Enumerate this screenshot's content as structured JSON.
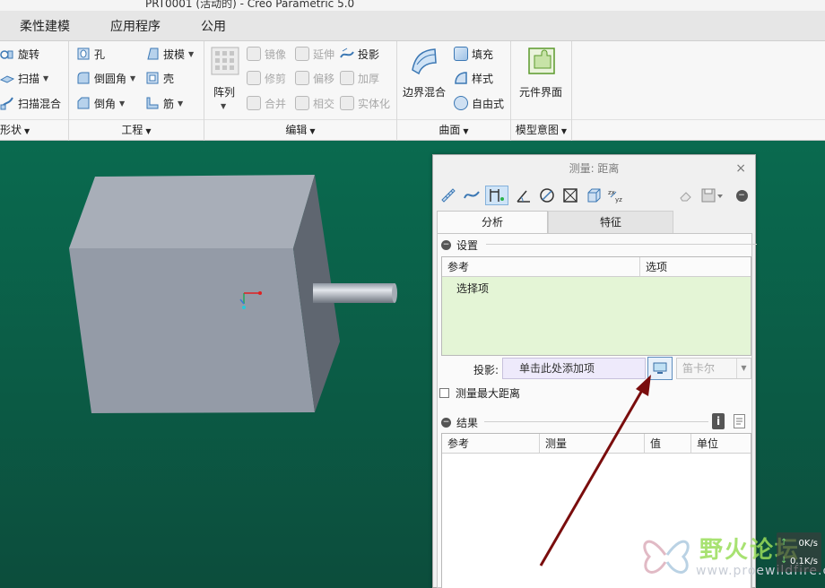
{
  "window": {
    "title": "PRT0001 (活动的) - Creo Parametric 5.0"
  },
  "tabs": [
    "柔性建模",
    "应用程序",
    "公用"
  ],
  "ribbon": {
    "groups": {
      "shape": {
        "label": "形状",
        "items": [
          "旋转",
          "扫描",
          "扫描混合"
        ]
      },
      "engineering": {
        "label": "工程",
        "items": [
          "孔",
          "倒圆角",
          "倒角",
          "拔模",
          "壳",
          "筋"
        ]
      },
      "editing": {
        "label": "编辑",
        "pattern": "阵列",
        "items": [
          "镜像",
          "修剪",
          "合并",
          "延伸",
          "偏移",
          "相交",
          "投影",
          "加厚",
          "实体化"
        ]
      },
      "surfaces": {
        "label": "曲面",
        "boundary": "边界混合",
        "items": [
          "填充",
          "样式",
          "自由式"
        ]
      },
      "model_intent": {
        "label": "模型意图",
        "component_interface": "元件界面"
      }
    }
  },
  "dialog": {
    "title": "测量: 距离",
    "close": "×",
    "tabs": [
      "分析",
      "特征"
    ],
    "setup": {
      "header": "设置",
      "columns": [
        "参考",
        "选项"
      ],
      "reference_item": "选择项",
      "projection_label": "投影:",
      "projection_placeholder": "单击此处添加项",
      "coord_system": "笛卡尔",
      "max_distance_label": "测量最大距离"
    },
    "results": {
      "header": "结果",
      "columns": [
        "参考",
        "测量",
        "值",
        "单位"
      ]
    }
  },
  "watermark": {
    "title": "野火论坛",
    "url": "www.proewildfire.cn"
  },
  "network": {
    "up": "0K/s",
    "down": "0.1K/s"
  },
  "colors": {
    "viewport": "#0b5a45",
    "part_front": "#949ba7",
    "part_side": "#5f6670",
    "part_top": "#a8aeb8",
    "arrow": "#7a0d0d",
    "reference_area": "#e4f5d6"
  }
}
